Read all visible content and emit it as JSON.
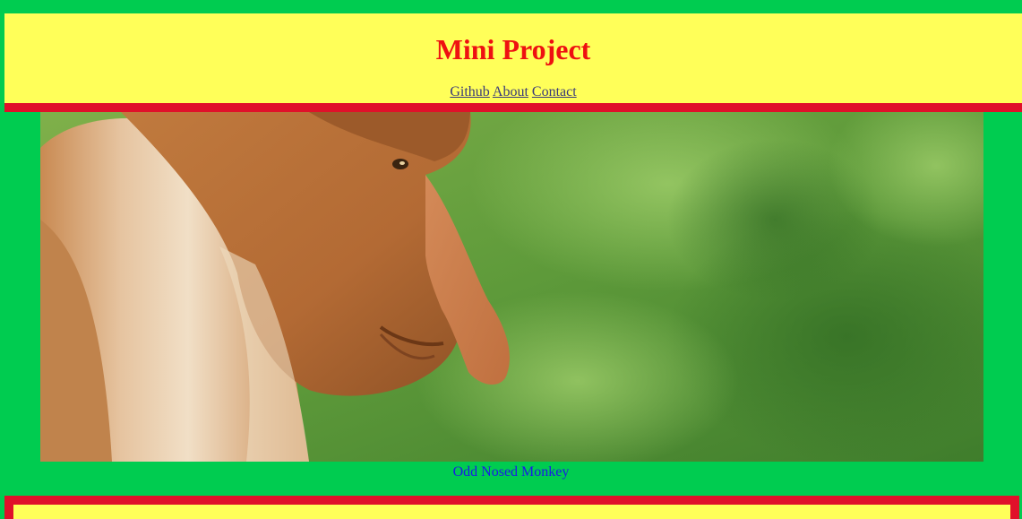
{
  "header": {
    "title": "Mini Project",
    "nav": [
      {
        "label": "Github"
      },
      {
        "label": "About"
      },
      {
        "label": "Contact"
      }
    ]
  },
  "hero": {
    "caption": "Odd Nosed Monkey"
  },
  "colors": {
    "page_background": "#00cc50",
    "header_background": "#ffff59",
    "title_color": "#ee1111",
    "border_red": "#e0102a",
    "caption_color": "#1a1ae6"
  }
}
